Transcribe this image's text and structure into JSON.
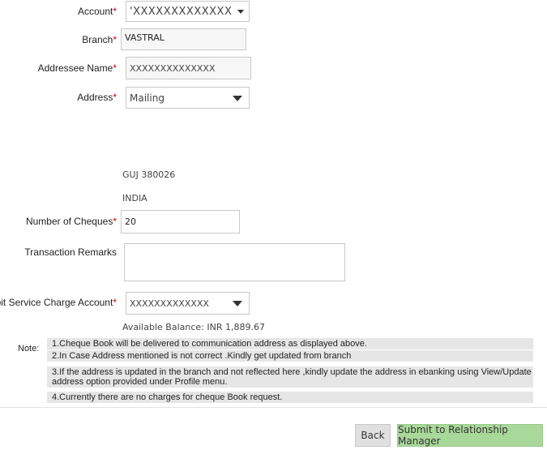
{
  "form": {
    "account": {
      "label": "Account",
      "value": "'XXXXXXXXXXXXX"
    },
    "branch": {
      "label": "Branch",
      "value": "VASTRAL"
    },
    "addressee_name": {
      "label": "Addressee Name",
      "value": "XXXXXXXXXXXXXX"
    },
    "address": {
      "label": "Address",
      "value": "Mailing"
    },
    "address_lines": [
      "GUJ 380026",
      "INDIA"
    ],
    "number_of_cheques": {
      "label": "Number of Cheques",
      "value": "20"
    },
    "transaction_remarks": {
      "label": "Transaction Remarks",
      "value": ""
    },
    "debit_account": {
      "label": "Debit Service Charge Account",
      "value": "XXXXXXXXXXXXX"
    },
    "available_balance": "Available Balance: INR 1,889.67",
    "required_marker": "*"
  },
  "note": {
    "label": "Note:",
    "items": [
      "1.Cheque Book will be delivered to communication address as displayed above.",
      "2.In Case Address mentioned is not correct .Kindly get updated from branch",
      "3.If the address is updated in the branch and not reflected here ,kindly update the address in ebanking using View/Update address option provided under Profile menu.",
      "4.Currently there are no charges for cheque Book request."
    ]
  },
  "actions": {
    "back": "Back",
    "submit": "Submit to Relationship Manager"
  },
  "colors": {
    "required": "#d00000",
    "submit_bg": "#a9d99a",
    "note_bg": "#e6e6e6"
  }
}
